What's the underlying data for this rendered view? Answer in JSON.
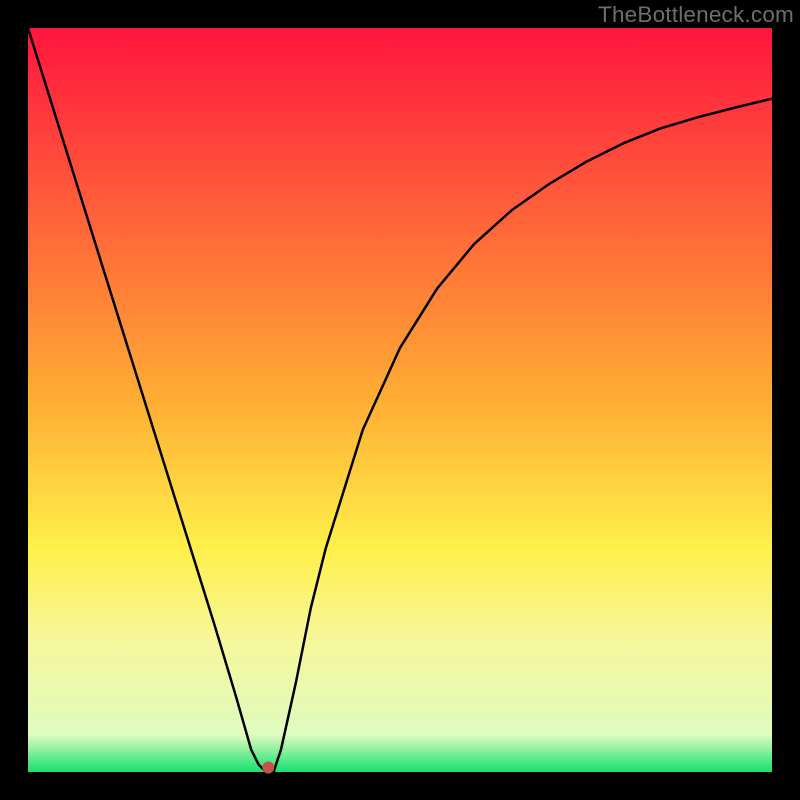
{
  "watermark": {
    "text": "TheBottleneck.com"
  },
  "chart_data": {
    "type": "line",
    "title": "",
    "xlabel": "",
    "ylabel": "",
    "xlim": [
      0,
      100
    ],
    "ylim": [
      0,
      100
    ],
    "grid": false,
    "legend": false,
    "background_gradient": {
      "stops": [
        {
          "pos": 0.0,
          "color": "#ff153f"
        },
        {
          "pos": 0.5,
          "color": "#ffad34"
        },
        {
          "pos": 0.7,
          "color": "#fff04a"
        },
        {
          "pos": 0.82,
          "color": "#f7f79a"
        },
        {
          "pos": 0.95,
          "color": "#dffcbf"
        },
        {
          "pos": 1.0,
          "color": "#14e070"
        }
      ]
    },
    "series": [
      {
        "name": "curve",
        "color": "#000000",
        "x": [
          0,
          5,
          10,
          15,
          20,
          25,
          28,
          30,
          31,
          32,
          33,
          34,
          36,
          38,
          40,
          45,
          50,
          55,
          60,
          65,
          70,
          75,
          80,
          85,
          90,
          95,
          100
        ],
        "values": [
          100,
          84,
          68,
          52,
          36,
          20,
          10,
          3,
          1,
          0,
          0,
          3,
          12,
          22,
          30,
          46,
          57,
          65,
          71,
          75.5,
          79,
          82,
          84.5,
          86.5,
          88,
          89.3,
          90.5
        ]
      }
    ],
    "marker": {
      "x": 32.3,
      "y": 0.6,
      "color": "#c1554b",
      "radius_px": 6
    },
    "frame": {
      "stroke": "#000000",
      "stroke_width_px": 28
    }
  }
}
